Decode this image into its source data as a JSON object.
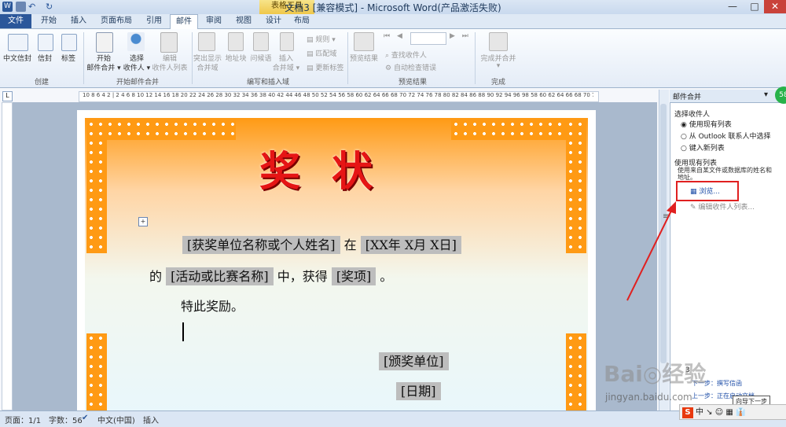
{
  "window": {
    "title": "文档3 [兼容模式] - Microsoft Word(产品激活失败)",
    "context_group": "表格工具",
    "minimize": "—",
    "maximize": "□",
    "close": "✕"
  },
  "tabs": [
    "文件",
    "开始",
    "插入",
    "页面布局",
    "引用",
    "邮件",
    "审阅",
    "视图",
    "设计",
    "布局"
  ],
  "ribbon": {
    "create": {
      "label": "创建",
      "cn_envelope": "中文信封",
      "envelope": "信封",
      "labels": "标签"
    },
    "start": {
      "label": "开始邮件合并",
      "start_merge": "开始",
      "start_merge2": "邮件合并 ▾",
      "select_recipients": "选择",
      "select_recipients2": "收件人 ▾",
      "edit_list": "编辑",
      "edit_list2": "收件人列表"
    },
    "write": {
      "label": "编写和插入域",
      "highlight": "突出显示",
      "highlight2": "合并域",
      "address_block": "地址块",
      "greeting": "问候语",
      "insert_field": "插入",
      "insert_field2": "合并域 ▾",
      "rules": "规则 ▾",
      "match_fields": "匹配域",
      "update_labels": "更新标签"
    },
    "preview": {
      "label": "预览结果",
      "preview_results": "预览结果",
      "find_recipient": "查找收件人",
      "auto_check": "自动检查错误"
    },
    "finish": {
      "label": "完成",
      "finish_merge": "完成并合并",
      "finish_merge_arrow": "▾"
    }
  },
  "ruler": {
    "ticks": "10 8 6 4 2 | 2 4 6 8 10 12 14 16 18 20 22 24 26 28 30 32 34 36 38 40 42 44 46 48 50 52 54 56 58 60 62 64 66 68 70 72 74 76 78 80 82 84 86 88 90 92 94 96 98 58 60 62 64 66 68 70 72 74 76 78 80 82 84 86 88 90 92 94 96 98"
  },
  "certificate": {
    "title": "奖状",
    "line1": {
      "field1": "[获奖单位名称或个人姓名]",
      "join": "在",
      "field2": "[XX年 X月 X日]"
    },
    "line2": {
      "prefix": "的",
      "field1": "[活动或比赛名称]",
      "mid": "中，获得",
      "field2": "[奖项]",
      "suffix": "。"
    },
    "line3": "特此奖励。",
    "issuer": "[颁奖单位]",
    "date": "[日期]"
  },
  "pane": {
    "title": "邮件合并",
    "select_recipients": "选择收件人",
    "opt1": "使用现有列表",
    "opt2": "从 Outlook 联系人中选择",
    "opt3": "键入新列表",
    "use_existing": "使用现有列表",
    "desc": "使用来自某文件或数据库的姓名和地址。",
    "browse": "浏览...",
    "edit_list": "编辑收件人列表...",
    "step": "3",
    "next": "下一步：撰写信函",
    "prev": "上一步：正在启动文档",
    "tooltip": "向导下一步"
  },
  "status": {
    "page": "页面：1/1",
    "words": "字数：56",
    "lang": "中文(中国)",
    "mode": "插入"
  },
  "watermark": {
    "text": "Bai◎经验",
    "url": "jingyan.baidu.com"
  },
  "ime": {
    "text": "中 ↘ ☺ ▦ 👔"
  },
  "badge": "58",
  "colors": {
    "accent": "#2b579a",
    "annotation": "#e02020",
    "cert_orange": "#ff9a14",
    "title_red": "#e61515"
  }
}
